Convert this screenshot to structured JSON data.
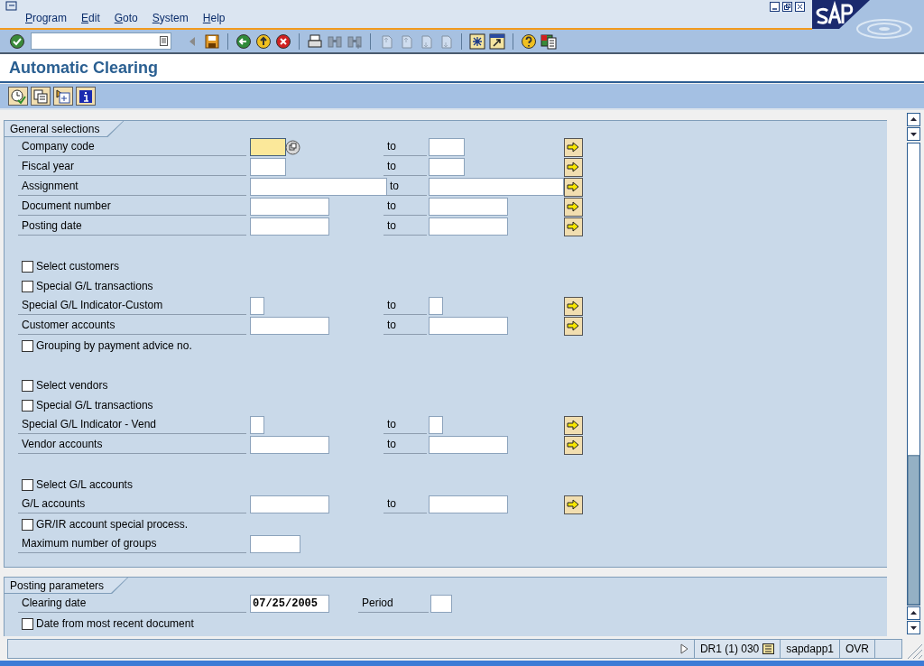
{
  "menu": [
    {
      "label": "Program"
    },
    {
      "label": "Edit"
    },
    {
      "label": "Goto"
    },
    {
      "label": "System"
    },
    {
      "label": "Help"
    }
  ],
  "toolbar": [
    {
      "kind": "enter",
      "disabled": false
    },
    {
      "kind": "command"
    },
    {
      "kind": "expand",
      "disabled": false
    },
    {
      "kind": "save",
      "disabled": false
    },
    {
      "kind": "sep"
    },
    {
      "kind": "back",
      "disabled": false
    },
    {
      "kind": "exit",
      "disabled": false
    },
    {
      "kind": "cancel",
      "disabled": false
    },
    {
      "kind": "sep"
    },
    {
      "kind": "print",
      "disabled": false
    },
    {
      "kind": "find",
      "disabled": true
    },
    {
      "kind": "find_next",
      "disabled": true
    },
    {
      "kind": "sep"
    },
    {
      "kind": "first_page",
      "disabled": true
    },
    {
      "kind": "prev_page",
      "disabled": true
    },
    {
      "kind": "next_page",
      "disabled": true
    },
    {
      "kind": "last_page",
      "disabled": true
    },
    {
      "kind": "sep"
    },
    {
      "kind": "new_session",
      "disabled": false
    },
    {
      "kind": "shortcut",
      "disabled": false
    },
    {
      "kind": "sep"
    },
    {
      "kind": "help",
      "disabled": false
    },
    {
      "kind": "layout",
      "disabled": false
    }
  ],
  "title": "Automatic Clearing",
  "app_toolbar": [
    {
      "kind": "execute"
    },
    {
      "kind": "variants"
    },
    {
      "kind": "dynamic_selections"
    },
    {
      "kind": "info"
    }
  ],
  "groups": [
    {
      "title": "General selections",
      "rows": [
        {
          "kind": "range",
          "label": "Company code",
          "input": {
            "kind": "code"
          },
          "required": true,
          "focused": true,
          "to": "to"
        },
        {
          "kind": "range",
          "label": "Fiscal year",
          "input": {
            "kind": "year"
          },
          "required": false,
          "focused": false,
          "to": "to"
        },
        {
          "kind": "range",
          "label": "Assignment",
          "input": {
            "kind": "text"
          },
          "required": false,
          "focused": false,
          "to": "to"
        },
        {
          "kind": "range",
          "label": "Document number",
          "input": {
            "kind": "number"
          },
          "required": false,
          "focused": false,
          "to": "to"
        },
        {
          "kind": "range",
          "label": "Posting date",
          "input": {
            "kind": "number"
          },
          "required": false,
          "focused": false,
          "to": "to"
        },
        {
          "kind": "blank"
        },
        {
          "kind": "checkbox",
          "label": "Select customers",
          "checked": false
        },
        {
          "kind": "checkbox",
          "label": "Special G/L transactions",
          "checked": false
        },
        {
          "kind": "range",
          "label": "Special G/L Indicator-Custom",
          "input": {
            "kind": "flag"
          },
          "required": false,
          "focused": false,
          "to": "to"
        },
        {
          "kind": "range",
          "label": "Customer accounts",
          "input": {
            "kind": "number"
          },
          "required": false,
          "focused": false,
          "to": "to"
        },
        {
          "kind": "checkbox",
          "label": "Grouping by payment advice no.",
          "checked": false
        },
        {
          "kind": "blank"
        },
        {
          "kind": "checkbox",
          "label": "Select vendors",
          "checked": false
        },
        {
          "kind": "checkbox",
          "label": "Special G/L transactions",
          "checked": false
        },
        {
          "kind": "range",
          "label": "Special G/L Indicator - Vend",
          "input": {
            "kind": "flag"
          },
          "required": false,
          "focused": false,
          "to": "to"
        },
        {
          "kind": "range",
          "label": "Vendor accounts",
          "input": {
            "kind": "number"
          },
          "required": false,
          "focused": false,
          "to": "to"
        },
        {
          "kind": "blank"
        },
        {
          "kind": "checkbox",
          "label": "Select G/L accounts",
          "checked": false
        },
        {
          "kind": "range",
          "label": "G/L accounts",
          "input": {
            "kind": "number"
          },
          "required": false,
          "focused": false,
          "to": "to"
        },
        {
          "kind": "checkbox",
          "label": "GR/IR account special process.",
          "checked": false
        },
        {
          "kind": "single",
          "label": "Maximum number of groups",
          "input": {
            "kind": "count"
          }
        }
      ]
    },
    {
      "title": "Posting parameters",
      "rows": [
        {
          "kind": "pair",
          "label": "Clearing date",
          "value": "07/25/2005",
          "label2": "Period"
        },
        {
          "kind": "checkbox",
          "label": "Date from most recent document",
          "checked": false
        }
      ]
    }
  ],
  "status_bar": {
    "system": "DR1 (1) 030",
    "server": "sapdapp1",
    "mode": "OVR"
  }
}
